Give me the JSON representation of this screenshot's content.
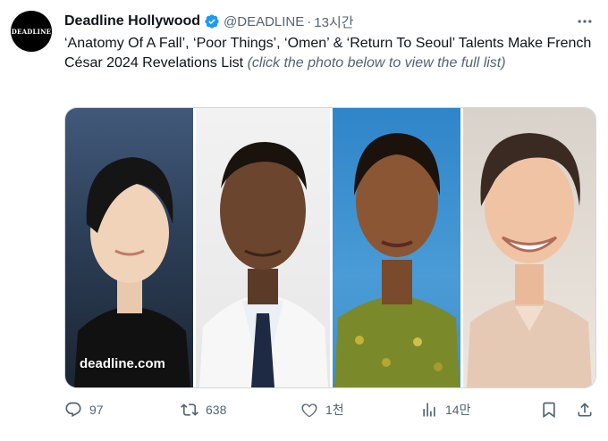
{
  "tweet": {
    "avatar_text": "DEADLINE",
    "display_name": "Deadline Hollywood",
    "handle": "@DEADLINE",
    "separator": "·",
    "time": "13시간",
    "text_main": "‘Anatomy Of A Fall’, ‘Poor Things’, ‘Omen’ & ‘Return To Seoul’ Talents Make French César 2024 Revelations List ",
    "text_note": "(click the photo below to view the full list)",
    "media_watermark": "deadline.com"
  },
  "actions": {
    "replies": "97",
    "reposts": "638",
    "likes": "1천",
    "views": "14만"
  },
  "colors": {
    "verified": "#1d9bf0",
    "secondary_text": "#536471",
    "primary_text": "#0f1419"
  },
  "icons": [
    "verified-badge-icon",
    "more-icon",
    "reply-icon",
    "repost-icon",
    "like-icon",
    "views-icon",
    "bookmark-icon",
    "share-icon"
  ]
}
